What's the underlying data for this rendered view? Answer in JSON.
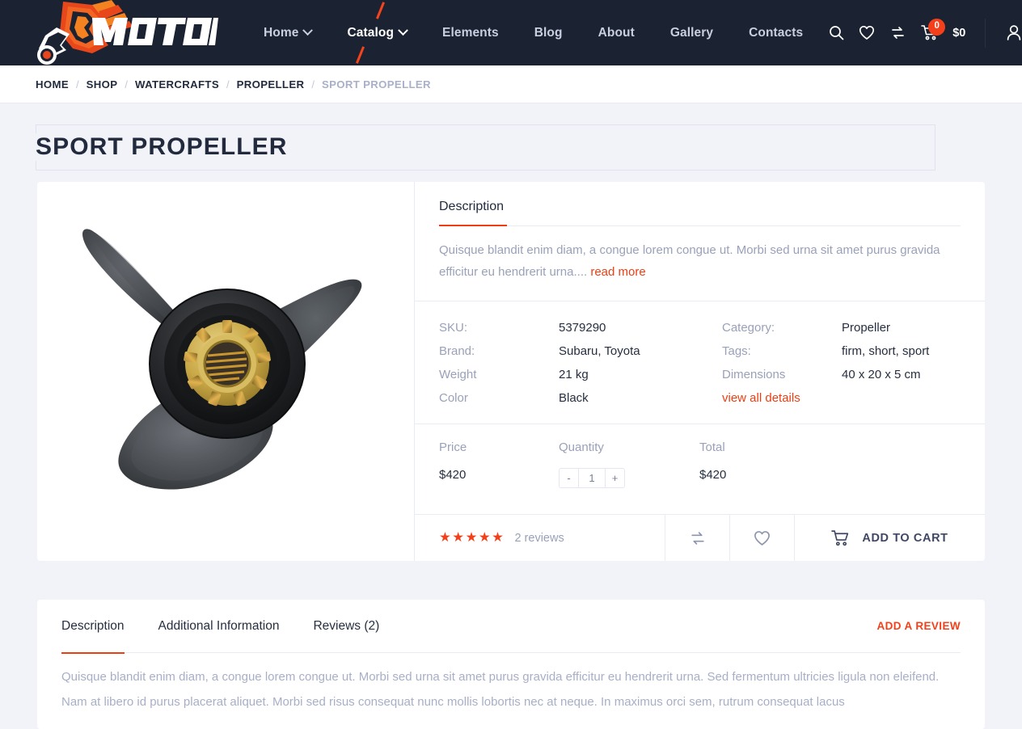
{
  "header": {
    "logo_text": "MOTOR",
    "nav": [
      {
        "label": "Home",
        "has_caret": true,
        "active": false
      },
      {
        "label": "Catalog",
        "has_caret": true,
        "active": true
      },
      {
        "label": "Elements",
        "has_caret": false,
        "active": false
      },
      {
        "label": "Blog",
        "has_caret": false,
        "active": false
      },
      {
        "label": "About",
        "has_caret": false,
        "active": false
      },
      {
        "label": "Gallery",
        "has_caret": false,
        "active": false
      },
      {
        "label": "Contacts",
        "has_caret": false,
        "active": false
      }
    ],
    "tools": {
      "search_icon": "search-icon",
      "wishlist_icon": "heart-icon",
      "compare_icon": "compare-icon",
      "cart_icon": "cart-icon",
      "cart_badge": "0",
      "cart_total": "$0",
      "account_icon": "user-icon"
    },
    "colors": {
      "background": "#1b2232",
      "accent": "#f4401a"
    }
  },
  "breadcrumb": {
    "separator": "/",
    "items": [
      {
        "label": "HOME",
        "current": false
      },
      {
        "label": "SHOP",
        "current": false
      },
      {
        "label": "WATERCRAFTS",
        "current": false
      },
      {
        "label": "PROPELLER",
        "current": false
      },
      {
        "label": "SPORT PROPELLER",
        "current": true
      }
    ]
  },
  "page": {
    "title": "SPORT PROPELLER"
  },
  "product": {
    "image_alt": "black three-blade sport propeller with brass splined hub",
    "description_tab": "Description",
    "description_text": "Quisque blandit enim diam, a congue lorem congue ut. Morbi sed urna sit amet purus gravida efficitur eu hendrerit urna....",
    "read_more": "read more",
    "specs_left": [
      {
        "label": "SKU:",
        "value": "5379290"
      },
      {
        "label": "Brand:",
        "value": "Subaru, Toyota"
      },
      {
        "label": "Weight",
        "value": "21 kg"
      },
      {
        "label": "Color",
        "value": "Black"
      }
    ],
    "specs_right": [
      {
        "label": "Category:",
        "value": "Propeller"
      },
      {
        "label": "Tags:",
        "value": "firm, short, sport"
      },
      {
        "label": "Dimensions",
        "value": "40 x 20 x 5 cm"
      }
    ],
    "view_all_details": "view all details",
    "price": {
      "label": "Price",
      "value": "$420"
    },
    "quantity": {
      "label": "Quantity",
      "decrement": "-",
      "value": "1",
      "increment": "+"
    },
    "total": {
      "label": "Total",
      "value": "$420"
    },
    "rating": {
      "stars": 5,
      "stars_glyph": "★★★★★",
      "reviews_text": "2 reviews"
    },
    "actions": {
      "compare_icon": "compare-icon",
      "wishlist_icon": "heart-icon",
      "cart_icon": "cart-icon",
      "add_to_cart": "ADD TO CART"
    }
  },
  "bottom": {
    "tabs": [
      {
        "label": "Description",
        "active": true
      },
      {
        "label": "Additional Information",
        "active": false
      },
      {
        "label": "Reviews (2)",
        "active": false
      }
    ],
    "add_review": "ADD A REVIEW",
    "body_text": "Quisque blandit enim diam, a congue lorem congue ut. Morbi sed urna sit amet purus gravida efficitur eu hendrerit urna. Sed fermentum ultricies ligula non eleifend. Nam at libero id purus placerat aliquet. Morbi sed risus consequat nunc mollis lobortis nec at neque. In maximus orci sem, rutrum consequat lacus"
  }
}
